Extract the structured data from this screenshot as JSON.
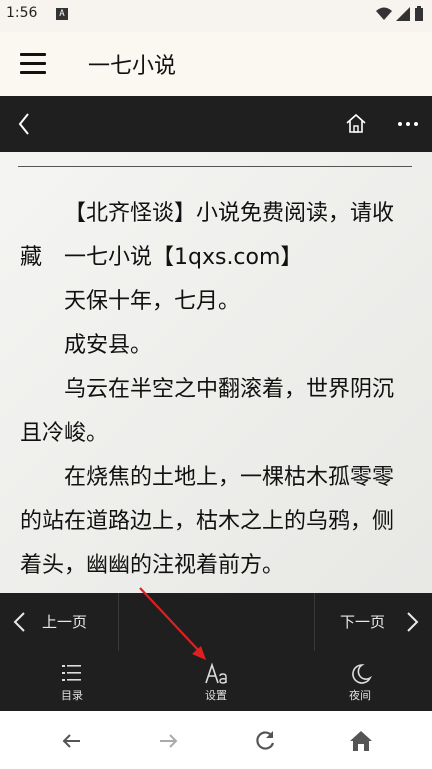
{
  "status": {
    "time": "1:56",
    "badge": "A"
  },
  "app": {
    "title": "一七小说"
  },
  "reader": {
    "paragraphs": [
      "【北齐怪谈】小说免费阅读，请收藏　一七小说【1qxs.com】",
      "天保十年，七月。",
      "成安县。",
      "乌云在半空之中翻滚着，世界阴沉且冷峻。",
      "在烧焦的土地上，一棵枯木孤零零的站在道路边上，枯木之上的乌鸦，侧着头，幽幽的注视着前方。"
    ]
  },
  "pager": {
    "prev": "上一页",
    "next": "下一页"
  },
  "toolbar": [
    {
      "label": "目录",
      "icon": "list-icon"
    },
    {
      "label": "设置",
      "icon": "font-settings-icon"
    },
    {
      "label": "夜间",
      "icon": "moon-icon"
    }
  ],
  "colors": {
    "dark": "#1f1f1f",
    "paper": "#efefec",
    "annotation": "#e02020"
  }
}
